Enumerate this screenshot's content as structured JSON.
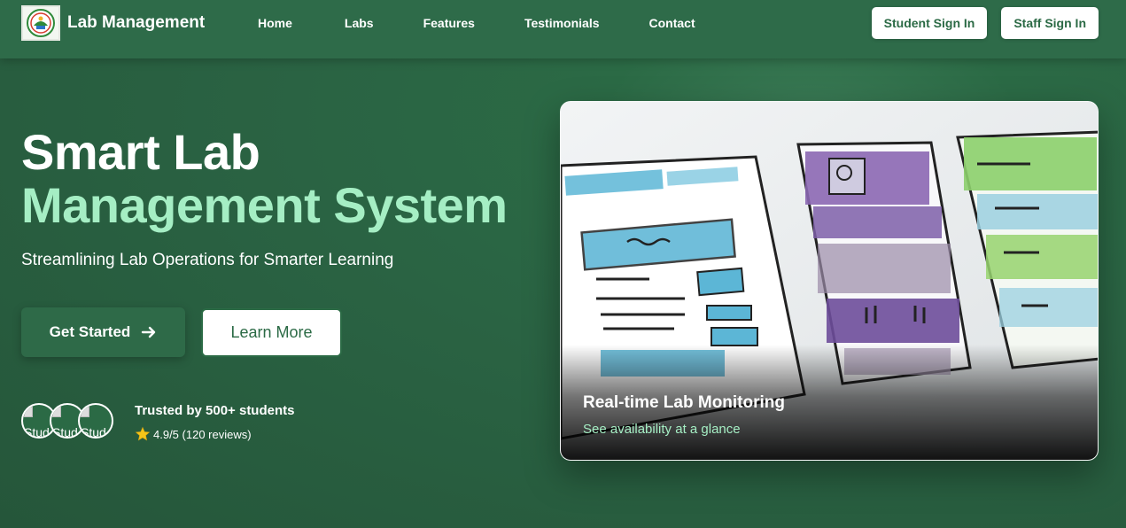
{
  "nav": {
    "brand": "Lab Management",
    "links": [
      "Home",
      "Labs",
      "Features",
      "Testimonials",
      "Contact"
    ],
    "student_signin": "Student Sign In",
    "staff_signin": "Staff Sign In"
  },
  "hero": {
    "title_line1": "Smart Lab",
    "title_line2": "Management System",
    "subtitle": "Streamlining Lab Operations for Smarter Learning",
    "primary_button": "Get Started",
    "secondary_button": "Learn More"
  },
  "social_proof": {
    "avatars": [
      {
        "alt": "Stud"
      },
      {
        "alt": "Stud"
      },
      {
        "alt": "Stud"
      }
    ],
    "title": "Trusted by 500+ students",
    "rating": "4.9/5 (120 reviews)"
  },
  "card": {
    "title": "Real-time Lab Monitoring",
    "subtitle": "See availability at a glance"
  },
  "colors": {
    "background": "#2a6343",
    "accent_text": "#a5eec4",
    "brand_green": "#2b6a45",
    "star": "#f5c518"
  },
  "icons": {
    "logo": "institution-seal-logo",
    "primary_button": "arrow-right-icon",
    "rating": "star-icon"
  }
}
